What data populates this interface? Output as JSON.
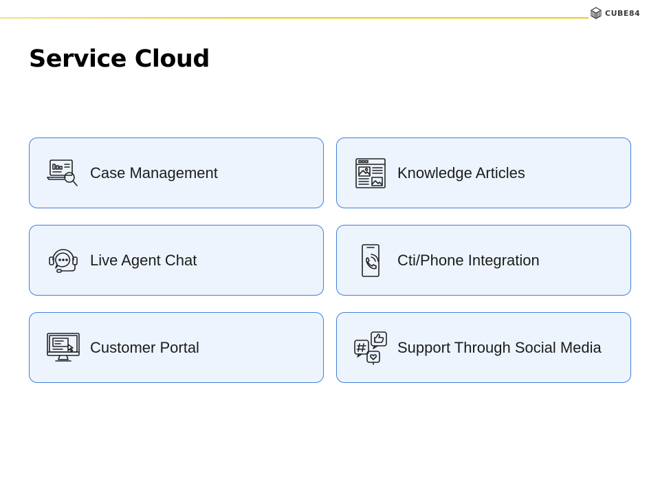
{
  "header": {
    "brand_text": "CUBE84",
    "brand_icon": "cube-logo-icon",
    "accent_color": "#f2c81a"
  },
  "title": "Service Cloud",
  "card_style": {
    "border_color": "#3d7fdb",
    "background_color": "#edf4fe"
  },
  "cards": [
    {
      "label": "Case Management",
      "icon": "laptop-search-icon"
    },
    {
      "label": "Knowledge Articles",
      "icon": "article-browser-icon"
    },
    {
      "label": "Live Agent Chat",
      "icon": "headset-chat-icon"
    },
    {
      "label": "Cti/Phone Integration",
      "icon": "phone-call-icon"
    },
    {
      "label": "Customer Portal",
      "icon": "monitor-portal-icon"
    },
    {
      "label": "Support Through Social Media",
      "icon": "social-media-icon"
    }
  ]
}
